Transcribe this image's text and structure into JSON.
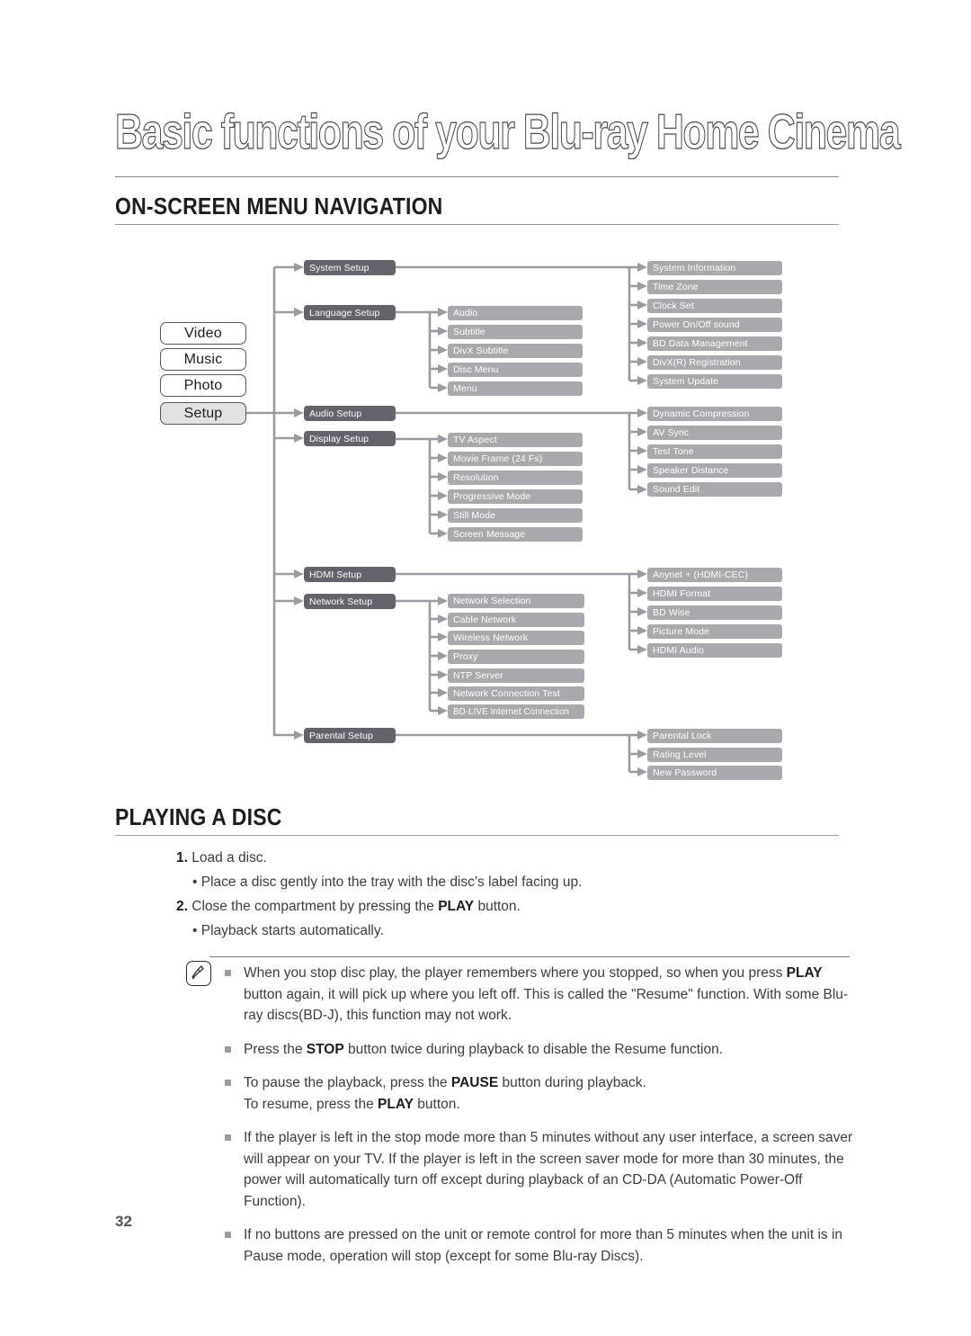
{
  "document": {
    "chapter_title": "Basic functions of your Blu-ray Home Cinema",
    "page_number": "32"
  },
  "sections": {
    "menu_navigation": {
      "heading": "ON-SCREEN MENU NAVIGATION"
    },
    "playing_a_disc": {
      "heading": "PLAYING A DISC"
    }
  },
  "diagram": {
    "left_menu": [
      {
        "label": "Video",
        "selected": false
      },
      {
        "label": "Music",
        "selected": false
      },
      {
        "label": "Photo",
        "selected": false
      },
      {
        "label": "Setup",
        "selected": true
      }
    ],
    "branches": [
      {
        "label": "System Setup",
        "children": [
          "System Information",
          "Time Zone",
          "Clock Set",
          "Power On/Off sound",
          "BD Data Management",
          "DivX(R) Registration",
          "System Update"
        ]
      },
      {
        "label": "Language Setup",
        "children": [
          "Audio",
          "Subtitle",
          "DivX Subtitle",
          "Disc Menu",
          "Menu"
        ]
      },
      {
        "label": "Audio Setup",
        "children": [
          "Dynamic Compression",
          "AV Sync",
          "Test Tone",
          "Speaker Distance",
          "Sound Edit"
        ]
      },
      {
        "label": "Display Setup",
        "children": [
          "TV Aspect",
          "Movie Frame (24 Fs)",
          "Resolution",
          "Progressive Mode",
          "Still Mode",
          "Screen Message"
        ]
      },
      {
        "label": "HDMI Setup",
        "children": [
          "Anynet + (HDMI-CEC)",
          "HDMI Format",
          "BD Wise",
          "Picture Mode",
          "HDMI Audio"
        ]
      },
      {
        "label": "Network Setup",
        "children": [
          "Network Selection",
          "Cable Network",
          "Wireless Network",
          "Proxy",
          "NTP Server",
          "Network Connection Test",
          "BD-LIVE Internet Connection"
        ]
      },
      {
        "label": "Parental Setup",
        "children": [
          "Parental Lock",
          "Rating Level",
          "New Password"
        ]
      }
    ],
    "colors": {
      "node_dark": "#63636b",
      "node_light": "#a9a9ad",
      "connector": "#9a9aa0",
      "selected_fill": "#e2e2e2"
    }
  },
  "playing_a_disc_steps": {
    "step1_num": "1.",
    "step1_text": "Load a disc.",
    "step1_bullet": "Place a disc gently into the tray with the disc’s label facing up.",
    "step2_num": "2.",
    "step2_text_a": "Close the compartment by pressing the ",
    "step2_bold": "PLAY",
    "step2_text_b": " button.",
    "step2_bullet": "Playback starts automatically."
  },
  "notes": {
    "icon": "memo-pencil-icon",
    "items": [
      {
        "parts": [
          {
            "t": "When you stop disc play, the player remembers where you stopped, so when you press ",
            "b": false
          },
          {
            "t": "PLAY",
            "b": true
          },
          {
            "t": " button again, it will pick up where you left off. This is called the \"Resume\" function. With some Blu-ray discs(BD-J), this function may not work.",
            "b": false
          }
        ]
      },
      {
        "parts": [
          {
            "t": "Press the ",
            "b": false
          },
          {
            "t": "STOP",
            "b": true
          },
          {
            "t": " button twice during playback to disable the Resume function.",
            "b": false
          }
        ]
      },
      {
        "parts": [
          {
            "t": "To pause the playback, press the ",
            "b": false
          },
          {
            "t": "PAUSE",
            "b": true
          },
          {
            "t": " button during playback.",
            "b": false
          },
          {
            "t": "\nTo resume, press the ",
            "b": false
          },
          {
            "t": "PLAY",
            "b": true
          },
          {
            "t": " button.",
            "b": false
          }
        ]
      },
      {
        "parts": [
          {
            "t": "If the player is left in the stop mode more than 5 minutes without any user interface, a screen saver will appear on your TV. If the player is left in the screen saver mode for more than 30 minutes, the power will automatically turn off except during playback of an CD-DA (Automatic Power-Off Function).",
            "b": false
          }
        ]
      },
      {
        "parts": [
          {
            "t": "If no buttons are pressed on the unit or remote control for more than 5 minutes when the unit is in Pause mode, operation will stop (except for some Blu-ray Discs).",
            "b": false
          }
        ]
      }
    ]
  }
}
